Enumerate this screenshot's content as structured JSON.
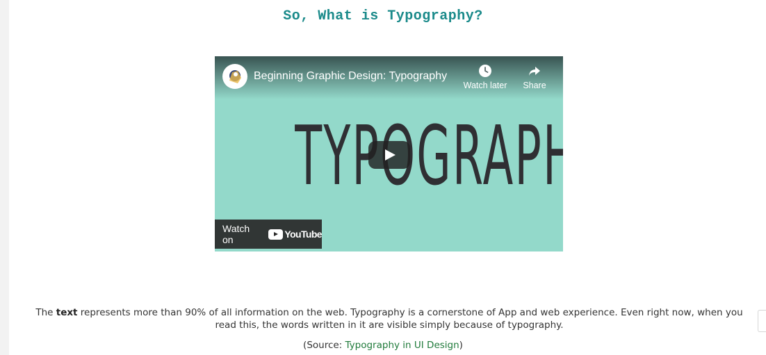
{
  "page": {
    "title": "So, What is Typography?"
  },
  "video": {
    "title": "Beginning Graphic Design: Typography",
    "watch_later_label": "Watch later",
    "share_label": "Share",
    "thumbnail_text": "TYPOGRAPHY",
    "watch_on_label": "Watch on",
    "youtube_label": "YouTube",
    "background_color": "#93d9ca"
  },
  "content": {
    "paragraph_bold": "text",
    "paragraph_before": "The ",
    "paragraph_after": " represents more than 90% of all information on the web. Typography is a cornerstone of App and web experience. Even right now, when you read this, the words written in it are visible simply because of typography.",
    "source_prefix": "(Source: ",
    "source_link": "Typography in UI Design",
    "source_suffix": ")"
  },
  "colors": {
    "title": "#1a8a8a",
    "link": "#1f7a3a"
  }
}
